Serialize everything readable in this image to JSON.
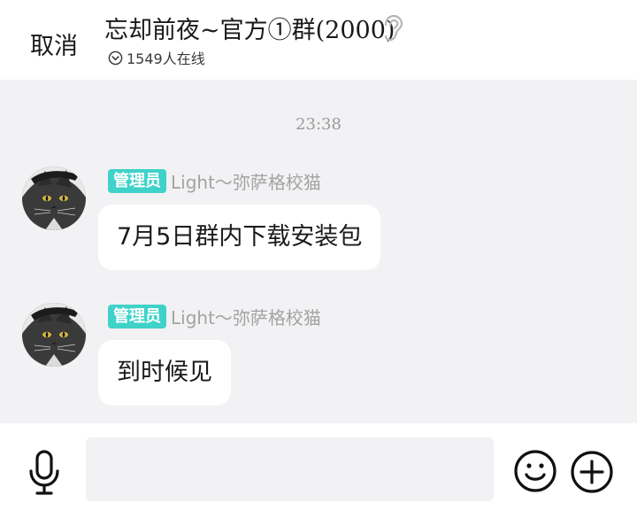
{
  "header": {
    "cancel_label": "取消",
    "title": "忘却前夜~官方①群(2000)",
    "online_text": "1549人在线",
    "icons": {
      "ear": "ear-icon",
      "online_toggle": "chevron-down-circle-icon"
    }
  },
  "chat": {
    "timestamp": "23:38",
    "messages": [
      {
        "role_badge": "管理员",
        "sender": "Light～弥萨格校猫",
        "text": "7月5日群内下载安装包",
        "avatar": "black-cat-avatar"
      },
      {
        "role_badge": "管理员",
        "sender": "Light～弥萨格校猫",
        "text": "到时候见",
        "avatar": "black-cat-avatar"
      }
    ]
  },
  "composer": {
    "input_value": "",
    "input_placeholder": "",
    "icons": {
      "voice": "microphone-icon",
      "emoji": "emoji-icon",
      "more": "plus-circle-icon"
    }
  },
  "colors": {
    "badge": "#3fd2c8",
    "chat_bg": "#f2f1f3",
    "bubble": "#ffffff",
    "sender": "#a3a3a3"
  }
}
